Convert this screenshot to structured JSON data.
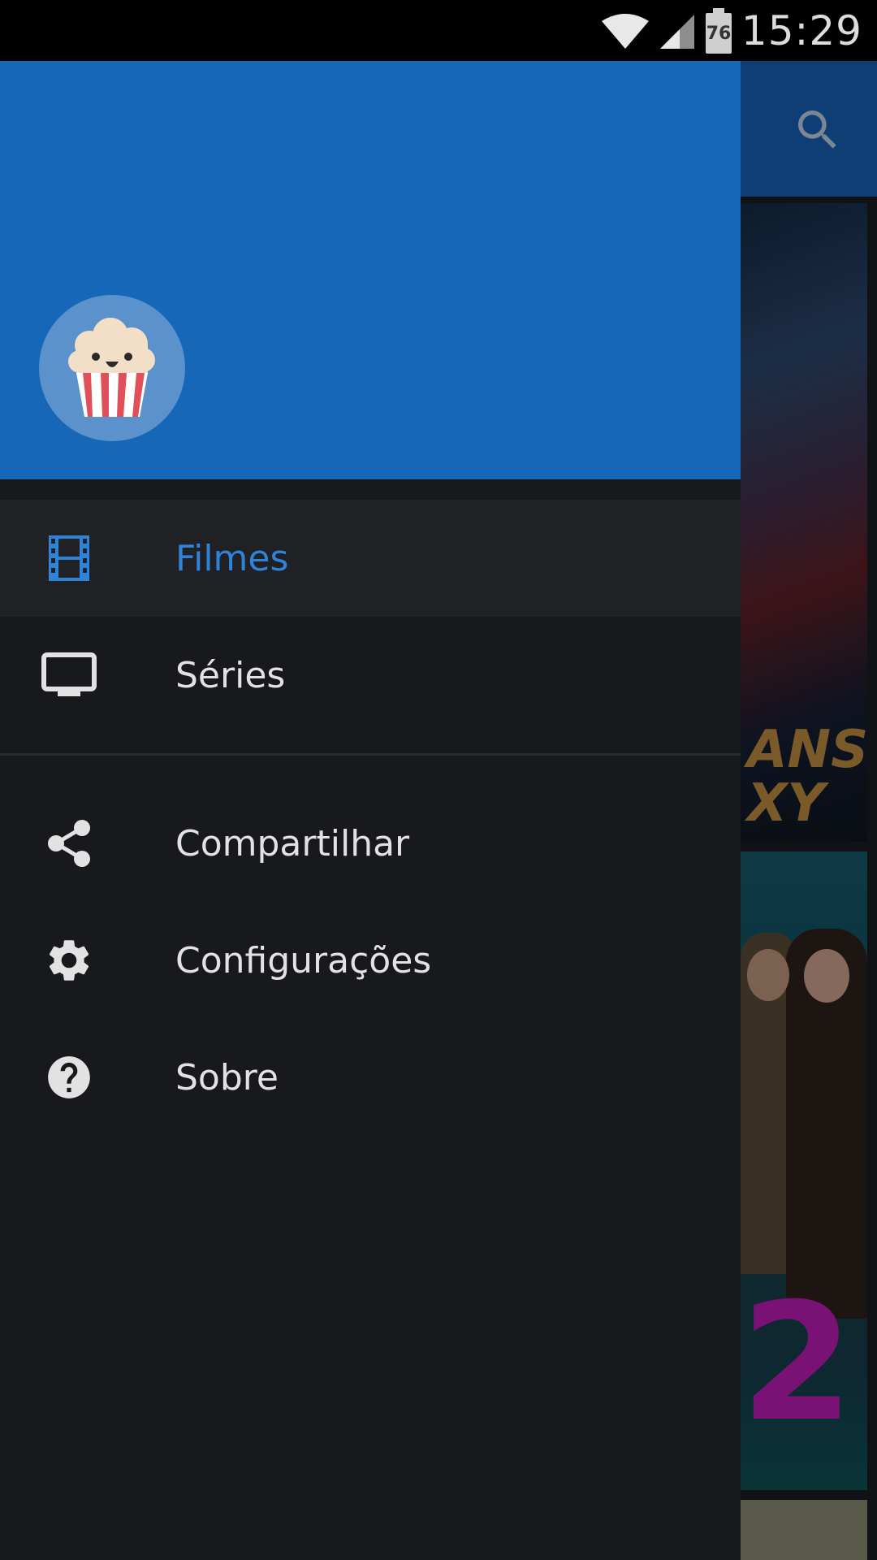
{
  "status_bar": {
    "time": "15:29",
    "battery_level": "76",
    "icons": [
      "wifi-icon",
      "signal-icon",
      "battery-icon"
    ]
  },
  "toolbar": {
    "search_icon": "search-icon"
  },
  "background": {
    "poster1_fragment": "ANS\nXY",
    "poster2_fragment": "2"
  },
  "drawer": {
    "header_color": "#1767b8",
    "logo": "popcorn-logo",
    "items": [
      {
        "label": "Filmes",
        "icon": "film-icon",
        "active": true
      },
      {
        "label": "Séries",
        "icon": "tv-icon",
        "active": false
      }
    ],
    "secondary_items": [
      {
        "label": "Compartilhar",
        "icon": "share-icon"
      },
      {
        "label": "Configurações",
        "icon": "settings-icon"
      },
      {
        "label": "Sobre",
        "icon": "help-icon"
      }
    ]
  },
  "colors": {
    "accent": "#2f83d9",
    "drawer_bg": "#18191d",
    "active_bg": "#202125"
  }
}
